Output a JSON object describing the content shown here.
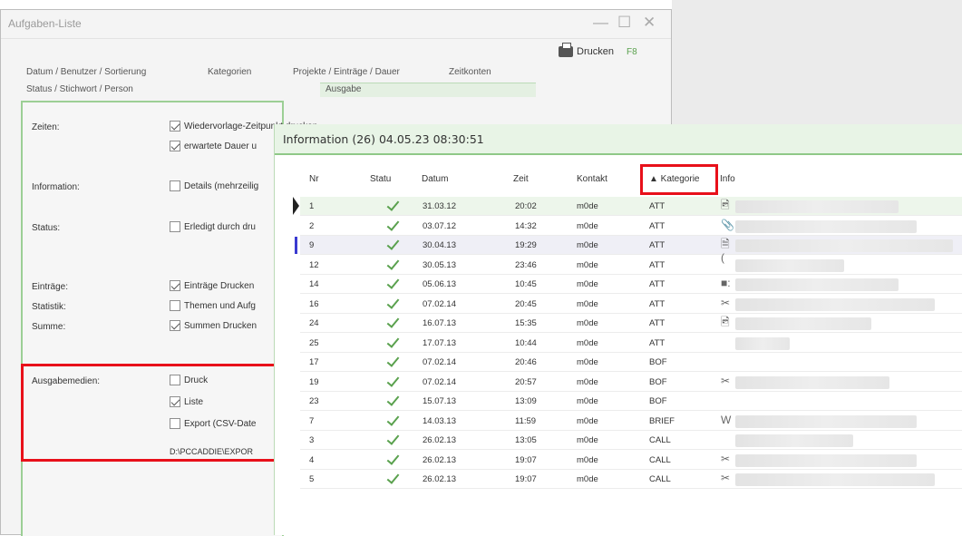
{
  "window": {
    "title": "Aufgaben-Liste",
    "controls": {
      "minimize": "—",
      "maximize": "☐",
      "close": "✕"
    }
  },
  "tabs": {
    "row1": [
      "Datum / Benutzer / Sortierung",
      "Kategorien",
      "Projekte / Einträge / Dauer",
      "Zeitkonten"
    ],
    "row2": [
      "Status / Stichwort / Person",
      "Ausgabe"
    ]
  },
  "print": {
    "label": "Drucken",
    "key": "F8"
  },
  "settings": {
    "zeiten": {
      "label": "Zeiten:",
      "opt1": "Wiedervorlage-Zeitpunkt drucken",
      "opt2": "erwartete Dauer u"
    },
    "information": {
      "label": "Information:",
      "opt": "Details (mehrzeilig"
    },
    "status": {
      "label": "Status:",
      "opt": "Erledigt durch dru"
    },
    "eintraege": {
      "label": "Einträge:",
      "opt": "Einträge Drucken"
    },
    "statistik": {
      "label": "Statistik:",
      "opt": "Themen und Aufg"
    },
    "summe": {
      "label": "Summe:",
      "opt": "Summen Drucken"
    },
    "ausgabemedien": {
      "label": "Ausgabemedien:",
      "druck": "Druck",
      "liste": "Liste",
      "export": "Export (CSV-Date",
      "path": "D:\\PCCADDIE\\EXPOR"
    }
  },
  "info_window": {
    "title": "Information (26) 04.05.23 08:30:51",
    "headers": {
      "nr": "Nr",
      "status": "Statu",
      "datum": "Datum",
      "zeit": "Zeit",
      "kontakt": "Kontakt",
      "kategorie": "▲ Kategorie",
      "info": "Info"
    },
    "rows": [
      {
        "nr": "1",
        "datum": "31.03.12",
        "zeit": "20:02",
        "kontakt": "m0de",
        "kategorie": "ATT",
        "icon": "🖻"
      },
      {
        "nr": "2",
        "datum": "03.07.12",
        "zeit": "14:32",
        "kontakt": "m0de",
        "kategorie": "ATT",
        "icon": "📎"
      },
      {
        "nr": "9",
        "datum": "30.04.13",
        "zeit": "19:29",
        "kontakt": "m0de",
        "kategorie": "ATT",
        "icon": "🗎("
      },
      {
        "nr": "12",
        "datum": "30.05.13",
        "zeit": "23:46",
        "kontakt": "m0de",
        "kategorie": "ATT",
        "icon": ""
      },
      {
        "nr": "14",
        "datum": "05.06.13",
        "zeit": "10:45",
        "kontakt": "m0de",
        "kategorie": "ATT",
        "icon": "■:"
      },
      {
        "nr": "16",
        "datum": "07.02.14",
        "zeit": "20:45",
        "kontakt": "m0de",
        "kategorie": "ATT",
        "icon": "✂"
      },
      {
        "nr": "24",
        "datum": "16.07.13",
        "zeit": "15:35",
        "kontakt": "m0de",
        "kategorie": "ATT",
        "icon": "🖻"
      },
      {
        "nr": "25",
        "datum": "17.07.13",
        "zeit": "10:44",
        "kontakt": "m0de",
        "kategorie": "ATT",
        "icon": ""
      },
      {
        "nr": "17",
        "datum": "07.02.14",
        "zeit": "20:46",
        "kontakt": "m0de",
        "kategorie": "BOF",
        "icon": ""
      },
      {
        "nr": "19",
        "datum": "07.02.14",
        "zeit": "20:57",
        "kontakt": "m0de",
        "kategorie": "BOF",
        "icon": "✂"
      },
      {
        "nr": "23",
        "datum": "15.07.13",
        "zeit": "13:09",
        "kontakt": "m0de",
        "kategorie": "BOF",
        "icon": ""
      },
      {
        "nr": "7",
        "datum": "14.03.13",
        "zeit": "11:59",
        "kontakt": "m0de",
        "kategorie": "BRIEF",
        "icon": "W"
      },
      {
        "nr": "3",
        "datum": "26.02.13",
        "zeit": "13:05",
        "kontakt": "m0de",
        "kategorie": "CALL",
        "icon": ""
      },
      {
        "nr": "4",
        "datum": "26.02.13",
        "zeit": "19:07",
        "kontakt": "m0de",
        "kategorie": "CALL",
        "icon": "✂"
      },
      {
        "nr": "5",
        "datum": "26.02.13",
        "zeit": "19:07",
        "kontakt": "m0de",
        "kategorie": "CALL",
        "icon": "✂"
      }
    ]
  },
  "colors": {
    "accent_green": "#5aa14e",
    "highlight_red": "#e8101a",
    "panel_border": "#9ccf95"
  }
}
